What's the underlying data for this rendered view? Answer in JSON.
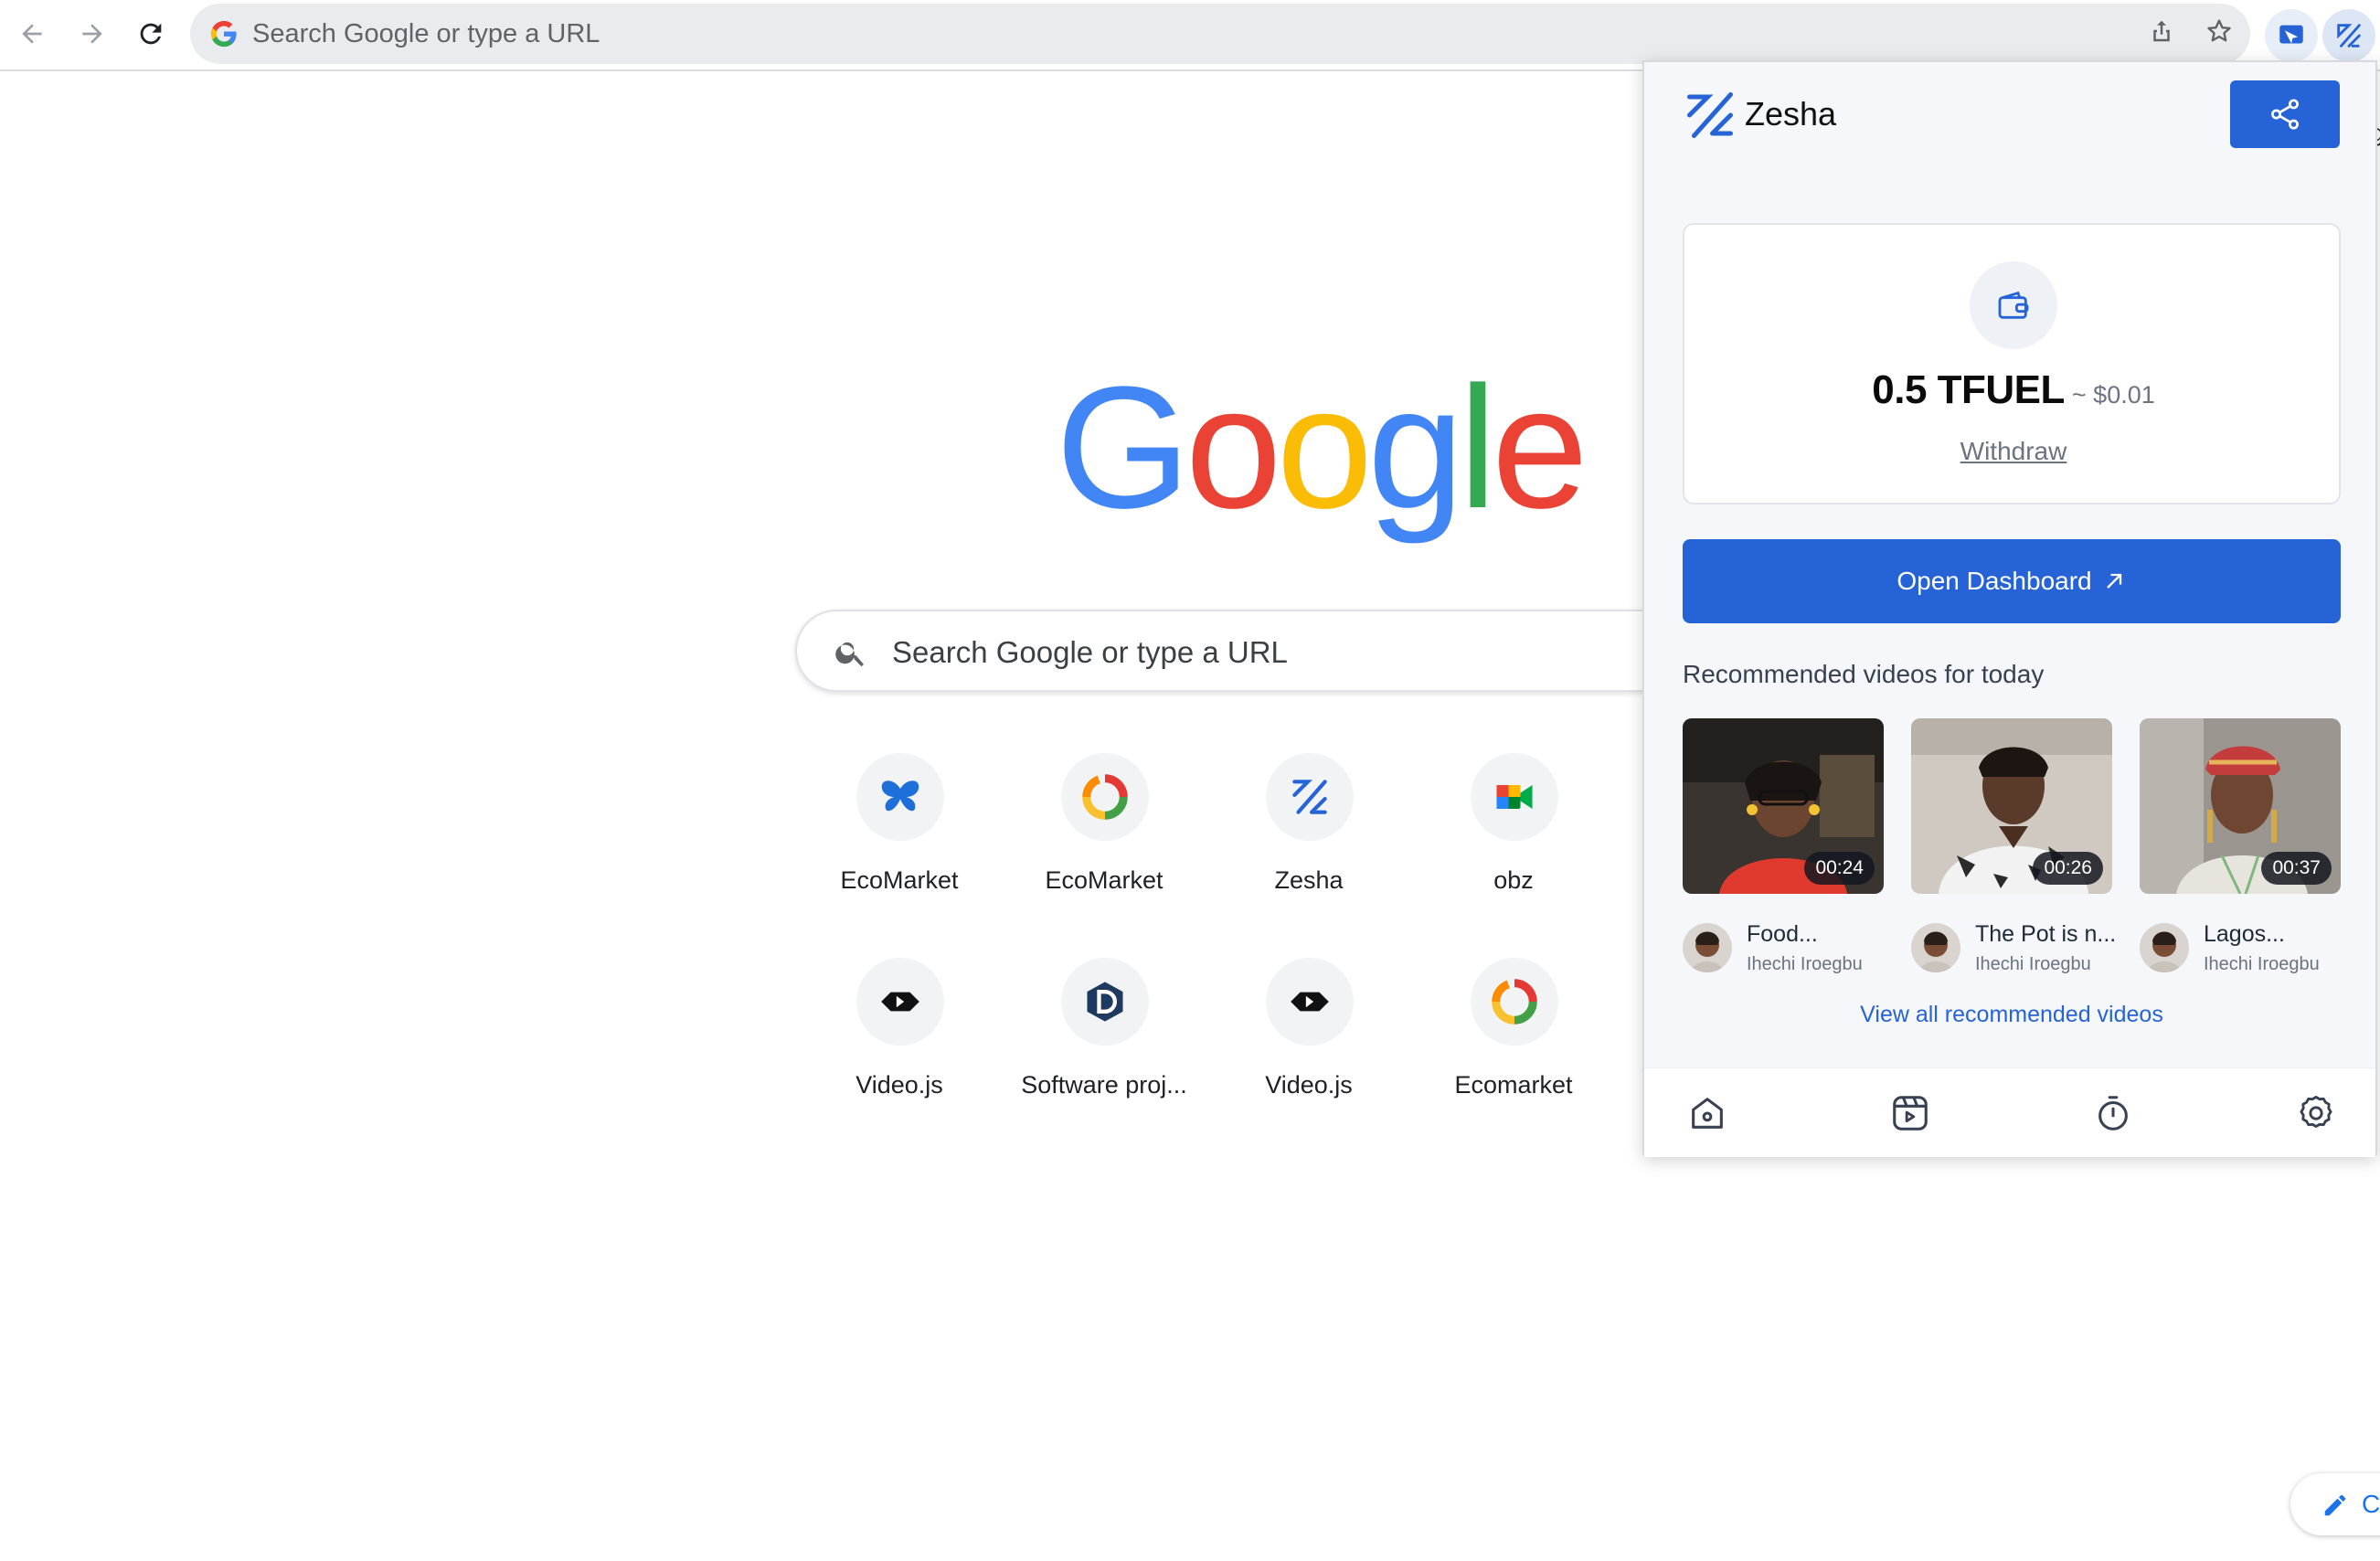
{
  "browser": {
    "omnibox_text": "Search Google or type a URL"
  },
  "google": {
    "logo": {
      "letters": [
        "G",
        "o",
        "o",
        "g",
        "l",
        "e"
      ],
      "colors": [
        "#4285F4",
        "#EA4335",
        "#FBBC05",
        "#4285F4",
        "#34A853",
        "#EA4335"
      ]
    },
    "search_placeholder": "Search Google or type a URL",
    "shortcuts": [
      {
        "label": "EcoMarket",
        "icon": "butterfly-icon"
      },
      {
        "label": "EcoMarket",
        "icon": "ecomarket-ring-icon"
      },
      {
        "label": "Zesha",
        "icon": "zesha-icon"
      },
      {
        "label": "obz",
        "icon": "meet-icon"
      },
      {
        "label": "Video.js",
        "icon": "videojs-icon"
      },
      {
        "label": "Software proj...",
        "icon": "d-hex-icon"
      },
      {
        "label": "Video.js",
        "icon": "videojs-icon"
      },
      {
        "label": "Ecomarket",
        "icon": "ecomarket-ring-icon"
      }
    ],
    "customize_label": "C",
    "edge_text": "g"
  },
  "popup": {
    "brand": "Zesha",
    "balance_amount": "0.5 TFUEL",
    "balance_usd": "~ $0.01",
    "withdraw": "Withdraw",
    "open_dashboard": "Open Dashboard",
    "recommended_title": "Recommended videos for today",
    "videos": [
      {
        "title": "Food...",
        "author": "Ihechi Iroegbu",
        "duration": "00:24"
      },
      {
        "title": "The Pot is n...",
        "author": "Ihechi Iroegbu",
        "duration": "00:26"
      },
      {
        "title": "Lagos...",
        "author": "Ihechi Iroegbu",
        "duration": "00:37"
      }
    ],
    "view_all": "View all recommended videos",
    "nav": [
      "home-icon",
      "videos-icon",
      "timer-icon",
      "settings-icon"
    ]
  },
  "colors": {
    "accent": "#2563d6",
    "google_blue": "#4285F4"
  }
}
